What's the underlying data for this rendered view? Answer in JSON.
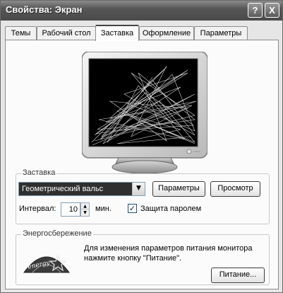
{
  "window": {
    "title": "Свойства: Экран",
    "help_button": "?",
    "close_button": "X"
  },
  "tabs": [
    {
      "label": "Темы",
      "active": false
    },
    {
      "label": "Рабочий стол",
      "active": false
    },
    {
      "label": "Заставка",
      "active": true
    },
    {
      "label": "Оформление",
      "active": false
    },
    {
      "label": "Параметры",
      "active": false
    }
  ],
  "screensaver": {
    "group_label": "Заставка",
    "selected": "Геометрический вальс",
    "settings_button": "Параметры",
    "preview_button": "Просмотр",
    "interval_label": "Интервал:",
    "interval_value": "10",
    "interval_unit": "мин.",
    "password_label": "Защита паролем",
    "password_checked": true,
    "checkmark": "✓"
  },
  "power": {
    "group_label": "Энергосбережение",
    "description_line1": "Для изменения параметров питания монитора",
    "description_line2": "нажмите кнопку \"Питание\".",
    "power_button": "Питание...",
    "logo_text": "energy"
  },
  "colors": {
    "titlebar": "#565656",
    "selection": "#2f2f2f",
    "panel": "#fbfbfb"
  }
}
